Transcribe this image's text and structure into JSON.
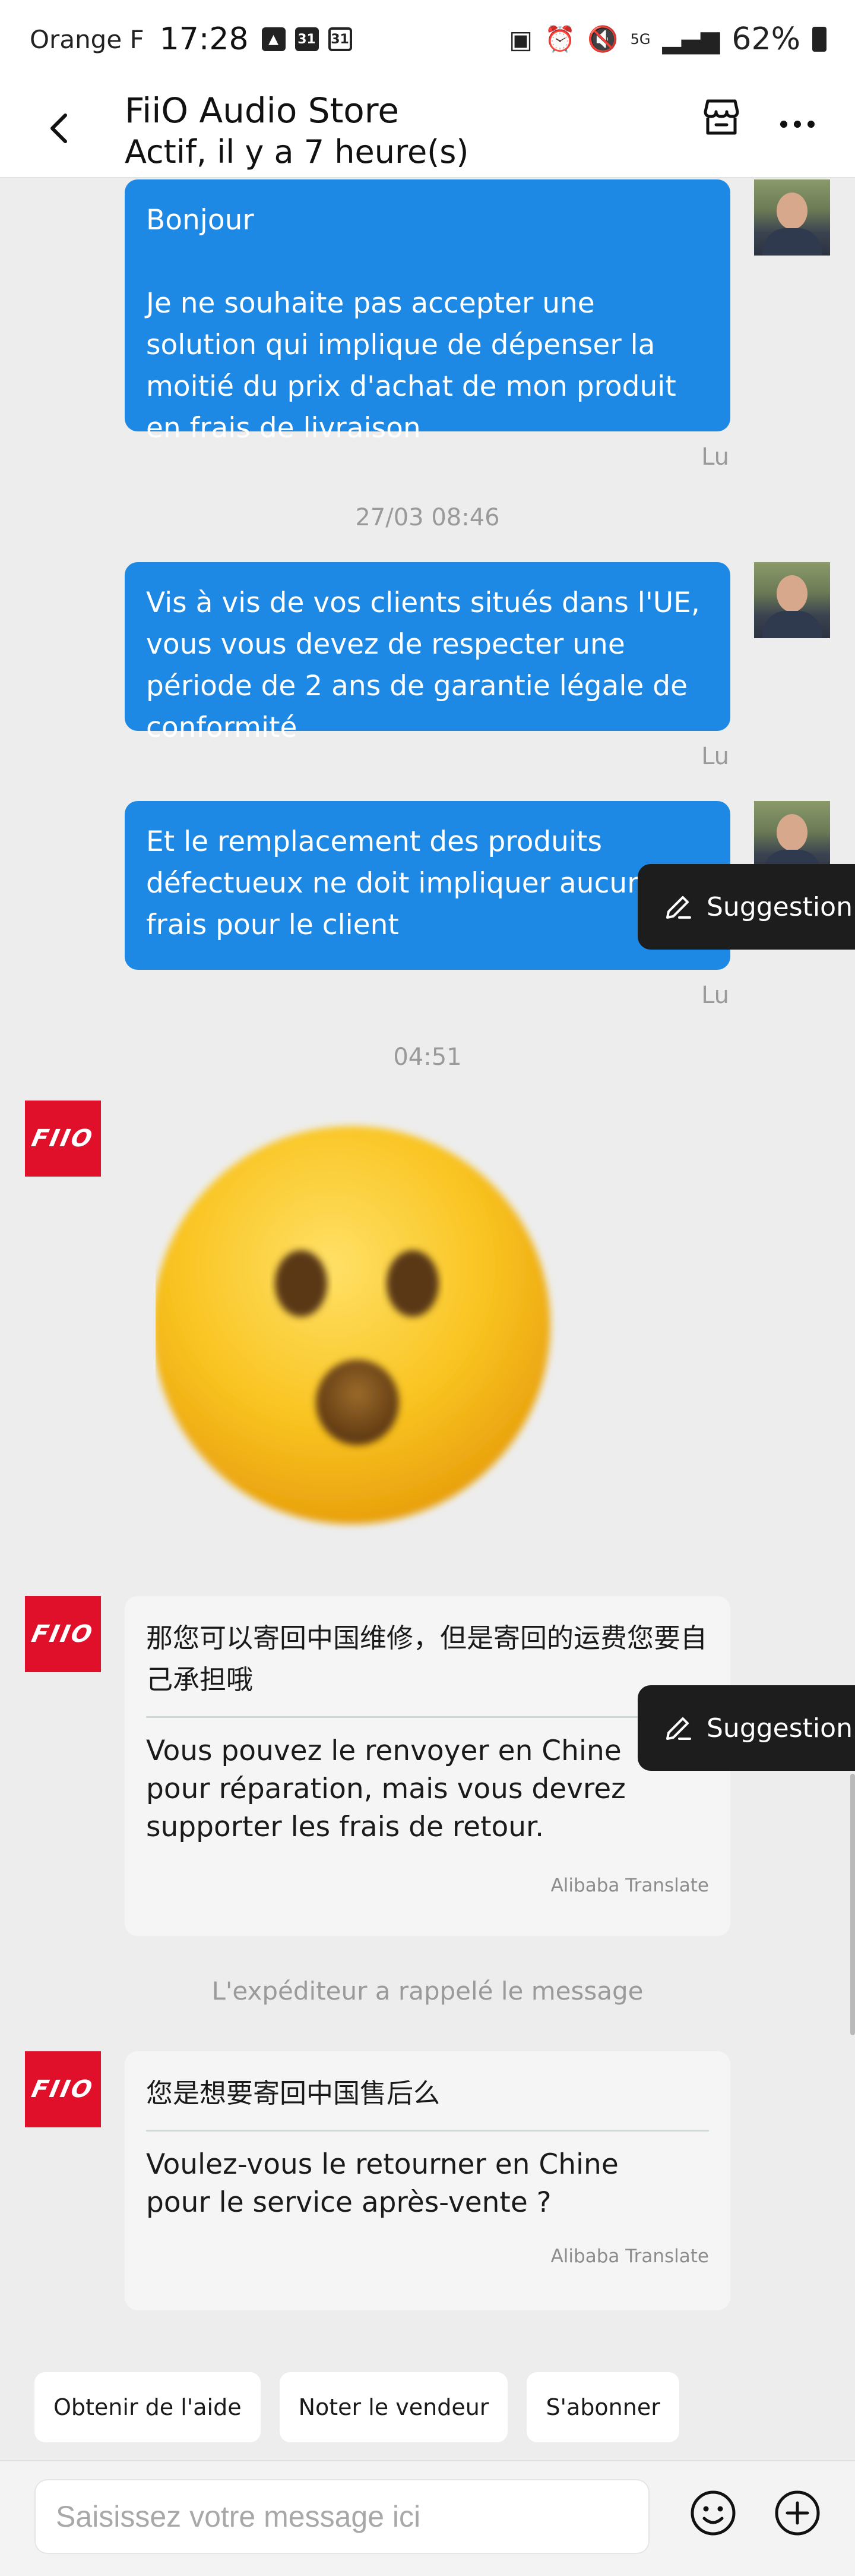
{
  "status_bar": {
    "carrier": "Orange F",
    "time": "17:28",
    "calendar_badge_1": "31",
    "calendar_badge_2": "31",
    "network": "5G",
    "battery": "62%"
  },
  "header": {
    "title": "FiiO Audio Store",
    "subtitle": "Actif, il y a 7 heure(s)"
  },
  "messages": {
    "m1": {
      "text_line1": "Bonjour",
      "text_rest": "Je ne souhaite pas accepter une solution qui implique de dépenser la moitié du prix d'achat de mon produit en frais de livraison",
      "status": "Lu"
    },
    "sep1": "27/03 08:46",
    "m2": {
      "text": "Vis à vis de vos clients situés dans l'UE, vous vous devez de respecter une période de 2 ans de garantie légale de conformité",
      "status": "Lu"
    },
    "m3": {
      "text": "Et le remplacement des produits défectueux ne doit impliquer aucun frais pour le client",
      "status": "Lu"
    },
    "sep2": "04:51",
    "shop_logo": "FIIO",
    "m5": {
      "original": "那您可以寄回中国维修，但是寄回的运费您要自己承担哦",
      "translation": "Vous pouvez le renvoyer en Chine pour réparation, mais vous devrez supporter les frais de retour.",
      "source": "Alibaba Translate"
    },
    "recall_note": "L'expéditeur a rappelé le message",
    "m6": {
      "original": "您是想要寄回中国售后么",
      "translation": "Voulez-vous le retourner en Chine pour le service après-vente ?",
      "source": "Alibaba Translate"
    }
  },
  "suggestion_label": "Suggestion",
  "quick_actions": [
    "Obtenir de l'aide",
    "Noter le vendeur",
    "S'abonner"
  ],
  "composer": {
    "placeholder": "Saisissez votre message ici"
  },
  "icons": {
    "back": "chevron-left-icon",
    "store": "store-icon",
    "more": "more-horizontal-icon",
    "suggestion": "pencil-icon",
    "emoji": "smiley-icon",
    "plus": "plus-circle-icon"
  },
  "colors": {
    "outgoing_bubble": "#1e88e5",
    "incoming_bubble": "#f5f5f5",
    "shop_brand": "#e0102b",
    "suggestion_bg": "#1d1d1d",
    "background": "#ededed"
  }
}
